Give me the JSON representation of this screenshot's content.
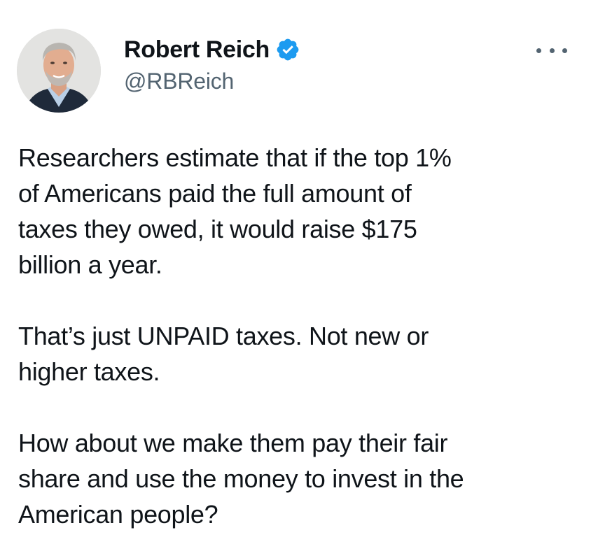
{
  "author": {
    "display_name": "Robert Reich",
    "handle": "@RBReich",
    "verified": true,
    "verified_icon": "verified-badge-icon",
    "verified_color": "#1d9bf0",
    "avatar": "profile-photo"
  },
  "menu": {
    "icon": "more-options-icon"
  },
  "tweet": {
    "paragraphs": [
      "Researchers estimate that if the top 1%\nof Americans paid the full amount of\ntaxes they owed, it would raise $175\nbillion a year.",
      "That’s just UNPAID taxes. Not new or\nhigher taxes.",
      "How about we make them pay their fair\nshare and use the money to invest in the\nAmerican people?"
    ]
  },
  "colors": {
    "text": "#0f1419",
    "secondary_text": "#536471",
    "background": "#ffffff"
  }
}
